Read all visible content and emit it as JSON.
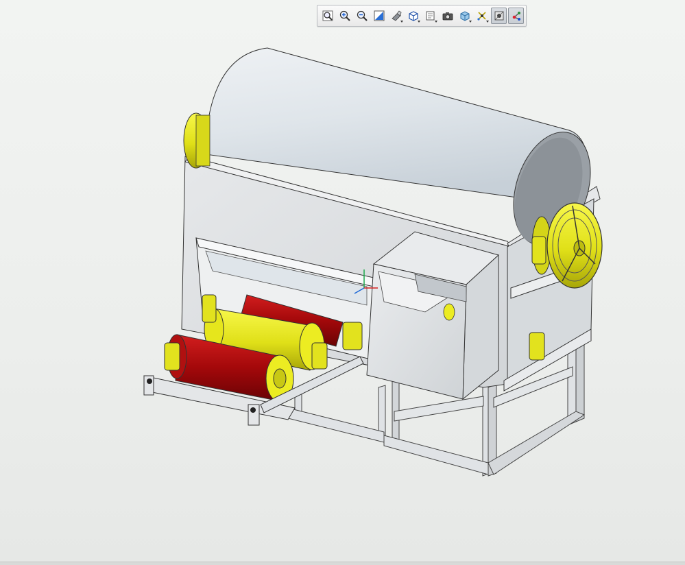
{
  "app": {
    "background_color": "#eceeec"
  },
  "toolbar": {
    "buttons": [
      {
        "name": "zoom-fit-button",
        "icon": "zoom-fit-icon",
        "pressed": false
      },
      {
        "name": "zoom-in-button",
        "icon": "zoom-in-icon",
        "pressed": false
      },
      {
        "name": "zoom-out-button",
        "icon": "zoom-out-icon",
        "pressed": false
      },
      {
        "name": "zoom-area-button",
        "icon": "zoom-area-icon",
        "pressed": false
      },
      {
        "name": "display-style-button",
        "icon": "display-style-icon",
        "pressed": false
      },
      {
        "name": "view-orientation-button",
        "icon": "cube-view-icon",
        "pressed": false
      },
      {
        "name": "section-view-button",
        "icon": "section-view-icon",
        "pressed": false
      },
      {
        "name": "render-button",
        "icon": "camera-icon",
        "pressed": false
      },
      {
        "name": "appearance-button",
        "icon": "appearance-icon",
        "pressed": false
      },
      {
        "name": "hide-show-items-button",
        "icon": "hide-show-icon",
        "pressed": false
      },
      {
        "name": "view-settings-button",
        "icon": "view-settings-icon",
        "pressed": true
      },
      {
        "name": "edit-appearance-button",
        "icon": "triad-icon",
        "pressed": true
      }
    ]
  },
  "model": {
    "description_icon": "rotary-drum-machine-3d-model",
    "colors": {
      "body": "#e2e4e6",
      "drum": "#dde3e8",
      "yellow": "#ecec22",
      "red": "#b0080a",
      "frame": "#dcdfe2"
    }
  }
}
